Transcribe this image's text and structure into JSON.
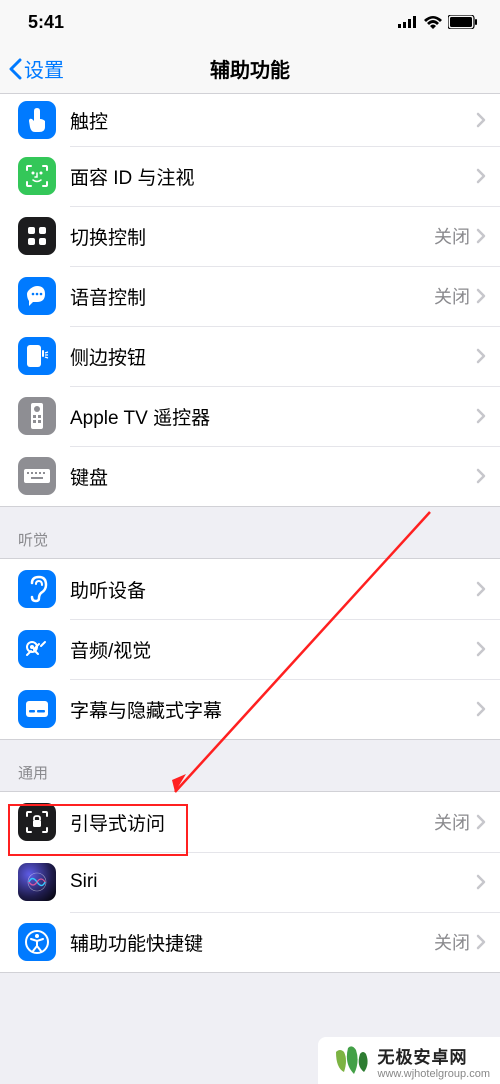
{
  "status": {
    "time": "5:41"
  },
  "nav": {
    "back_label": "设置",
    "title": "辅助功能"
  },
  "sections": [
    {
      "header": "",
      "items": [
        {
          "label": "触控",
          "value": ""
        },
        {
          "label": "面容 ID 与注视",
          "value": ""
        },
        {
          "label": "切换控制",
          "value": "关闭"
        },
        {
          "label": "语音控制",
          "value": "关闭"
        },
        {
          "label": "侧边按钮",
          "value": ""
        },
        {
          "label": "Apple TV 遥控器",
          "value": ""
        },
        {
          "label": "键盘",
          "value": ""
        }
      ]
    },
    {
      "header": "听觉",
      "items": [
        {
          "label": "助听设备",
          "value": ""
        },
        {
          "label": "音频/视觉",
          "value": ""
        },
        {
          "label": "字幕与隐藏式字幕",
          "value": ""
        }
      ]
    },
    {
      "header": "通用",
      "items": [
        {
          "label": "引导式访问",
          "value": "关闭"
        },
        {
          "label": "Siri",
          "value": ""
        },
        {
          "label": "辅助功能快捷键",
          "value": "关闭"
        }
      ]
    }
  ],
  "watermark": {
    "title": "无极安卓网",
    "sub": "www.wjhotelgroup.com"
  }
}
